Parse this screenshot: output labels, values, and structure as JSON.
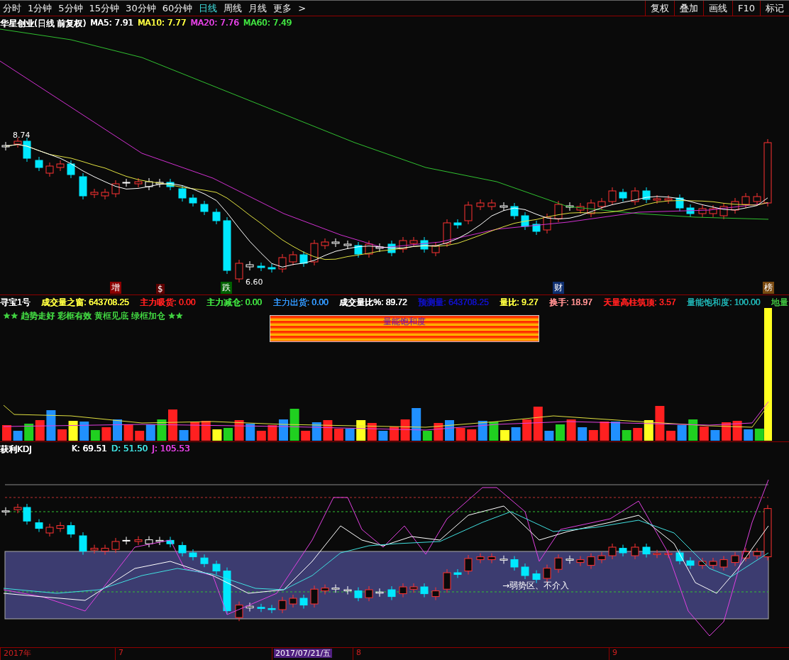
{
  "toolbar": {
    "periods": [
      {
        "label": "分时",
        "selected": false
      },
      {
        "label": "1分钟",
        "selected": false
      },
      {
        "label": "5分钟",
        "selected": false
      },
      {
        "label": "15分钟",
        "selected": false
      },
      {
        "label": "30分钟",
        "selected": false
      },
      {
        "label": "60分钟",
        "selected": false
      },
      {
        "label": "日线",
        "selected": true
      },
      {
        "label": "周线",
        "selected": false
      },
      {
        "label": "月线",
        "selected": false
      }
    ],
    "more": "更多",
    "more_arrow": ">",
    "buttons": [
      "复权",
      "叠加",
      "画线",
      "F10",
      "标记"
    ]
  },
  "price_pane": {
    "title": "华星创业(日线 前复权)",
    "indicators": [
      {
        "label": "MA5: 7.91",
        "color": "#ffffff"
      },
      {
        "label": "MA10: 7.77",
        "color": "#ffff40"
      },
      {
        "label": "MA20: 7.76",
        "color": "#e040e0"
      },
      {
        "label": "MA60: 7.49",
        "color": "#40e040"
      }
    ],
    "high_label": "8.74",
    "low_label": "6.60",
    "events": [
      {
        "text": "增",
        "color": "#8b0000"
      },
      {
        "text": "$",
        "color": "#600000"
      },
      {
        "text": "跌",
        "color": "#006000"
      },
      {
        "text": "财",
        "color": "#103070"
      },
      {
        "text": "榜",
        "color": "#7a4a10"
      }
    ]
  },
  "volume_pane": {
    "name": "寻宝1号",
    "readings": [
      {
        "label": "成交量之窗: 643708.25",
        "color": "#ffff40"
      },
      {
        "label": "主力吸货: 0.00",
        "color": "#ff2020"
      },
      {
        "label": "主力减仓: 0.00",
        "color": "#40e040"
      },
      {
        "label": "主力出货: 0.00",
        "color": "#3399ff"
      },
      {
        "label": "成交量比%: 89.72",
        "color": "#ffffff"
      },
      {
        "label": "预测量: 643708.25",
        "color": "#1010c0"
      },
      {
        "label": "量比: 9.27",
        "color": "#ffff40"
      },
      {
        "label": "换手: 18.97",
        "color": "#ff9090"
      },
      {
        "label": "天量高柱筑顶: 3.57",
        "color": "#ff2020"
      },
      {
        "label": "量能饱和度: 100.00",
        "color": "#20b0b0"
      },
      {
        "label": "地量",
        "color": "#40c040"
      }
    ],
    "slogan": "★★ 趋势走好 彩框有效 黄框见底 绿框加仓 ★★",
    "saturation_label": "量能饱和度"
  },
  "kdj_pane": {
    "name": "获利KDJ",
    "readings": [
      {
        "label": "K: 69.51",
        "color": "#ffffff"
      },
      {
        "label": "D: 51.50",
        "color": "#40e0e0"
      },
      {
        "label": "J: 105.53",
        "color": "#e040e0"
      }
    ],
    "zone_label": "→弱势区、不介入"
  },
  "time_axis": [
    {
      "label": "2017年",
      "selected": false
    },
    {
      "label": "7",
      "selected": false
    },
    {
      "label": "2017/07/21/五",
      "selected": true
    },
    {
      "label": "8",
      "selected": false
    },
    {
      "label": "9",
      "selected": false
    }
  ]
}
